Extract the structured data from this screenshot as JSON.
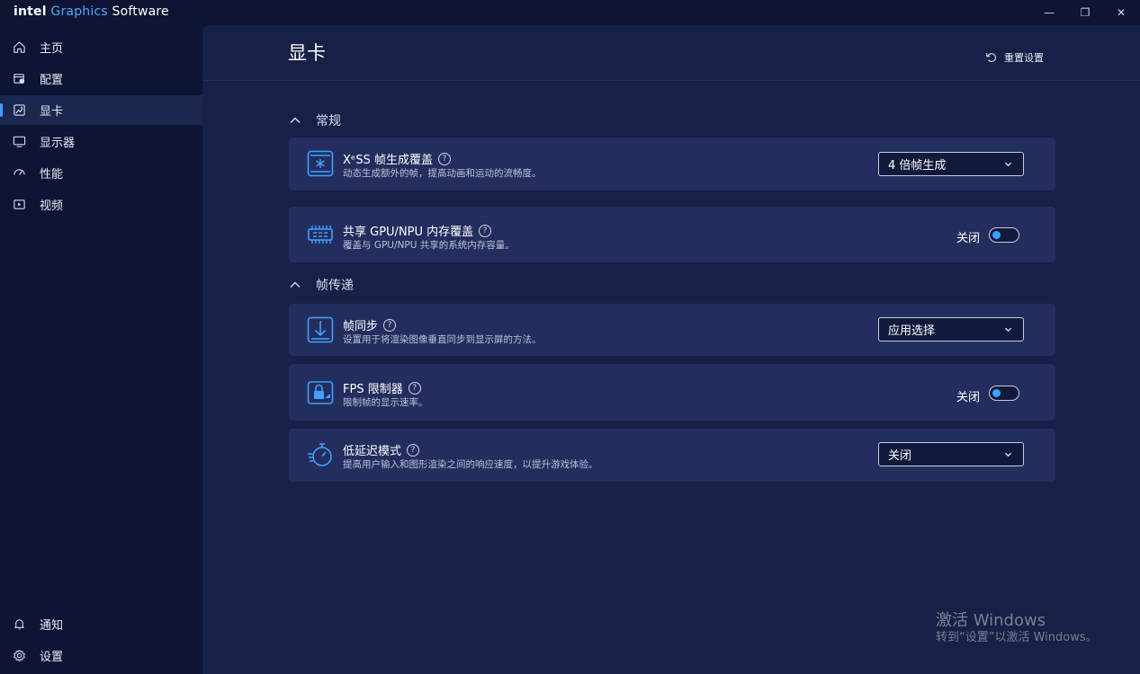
{
  "app": {
    "brand_intel": "intel",
    "brand_graphics": "Graphics",
    "brand_software": "Software",
    "minimize": "—",
    "restore": "❐",
    "close": "✕"
  },
  "sidebar": {
    "items": [
      {
        "label": "主页",
        "icon": "home-icon"
      },
      {
        "label": "配置",
        "icon": "profile-icon"
      },
      {
        "label": "显卡",
        "icon": "graphics-icon",
        "active": true
      },
      {
        "label": "显示器",
        "icon": "monitor-icon"
      },
      {
        "label": "性能",
        "icon": "gauge-icon"
      },
      {
        "label": "视频",
        "icon": "video-icon"
      }
    ],
    "bottom": [
      {
        "label": "通知",
        "icon": "bell-icon"
      },
      {
        "label": "设置",
        "icon": "gear-icon"
      }
    ]
  },
  "page": {
    "title": "显卡",
    "reset_label": "重置设置"
  },
  "sections": [
    {
      "title": "常规"
    },
    {
      "title": "帧传递"
    }
  ],
  "cards": {
    "xess": {
      "title": "XᵉSS 帧生成覆盖",
      "desc": "动态生成额外的帧，提高动画和运动的流畅度。",
      "value": "4 倍帧生成"
    },
    "shared_mem": {
      "title": "共享 GPU/NPU 内存覆盖",
      "desc": "覆盖与 GPU/NPU 共享的系统内存容量。",
      "state": "关闭"
    },
    "frame_sync": {
      "title": "帧同步",
      "desc": "设置用于将渲染图像垂直同步到显示屏的方法。",
      "value": "应用选择"
    },
    "fps_limiter": {
      "title": "FPS 限制器",
      "desc": "限制帧的显示速率。",
      "state": "关闭"
    },
    "low_latency": {
      "title": "低延迟模式",
      "desc": "提高用户输入和图形渲染之间的响应速度，以提升游戏体验。",
      "value": "关闭"
    }
  },
  "help_glyph": "?",
  "watermark": {
    "line1": "激活 Windows",
    "line2": "转到“设置”以激活 Windows。"
  },
  "colors": {
    "accent": "#3da2ff",
    "background": "#0d1532",
    "panel": "#172046",
    "card": "#232e5e"
  }
}
